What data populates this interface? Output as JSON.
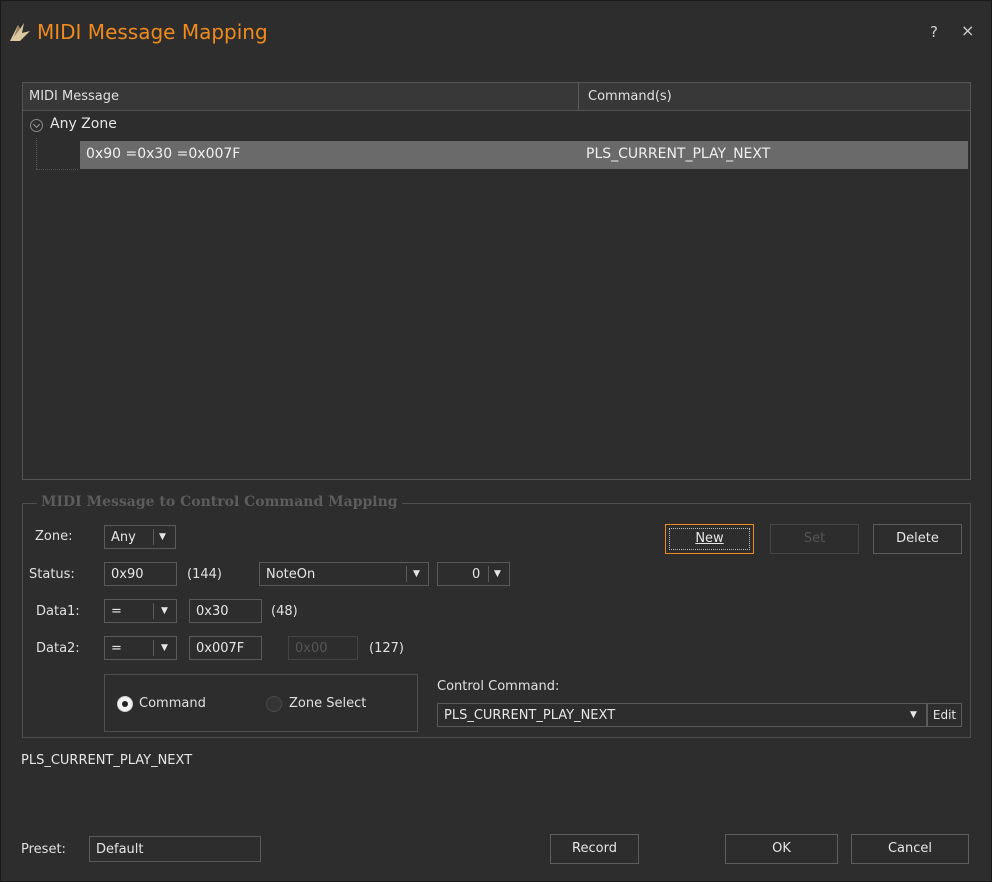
{
  "window": {
    "title": "MIDI Message Mapping",
    "help_label": "?",
    "close_label": "×",
    "accent_color": "#f08a1d"
  },
  "mapping_list": {
    "columns": [
      "MIDI Message",
      "Command(s)"
    ],
    "group_label": "Any Zone",
    "rows": [
      {
        "message": "0x90 =0x30 =0x007F",
        "command": "PLS_CURRENT_PLAY_NEXT"
      }
    ]
  },
  "editor": {
    "group_title": "MIDI Message to Control Command Mapping",
    "zone_label": "Zone:",
    "zone_value": "Any",
    "status_label": "Status:",
    "status_value": "0x90",
    "status_decimal": "(144)",
    "status_type": "NoteOn",
    "status_channel": "0",
    "data1_label": "Data1:",
    "data1_operator": "=",
    "data1_value": "0x30",
    "data1_decimal": "(48)",
    "data2_label": "Data2:",
    "data2_operator": "=",
    "data2_value": "0x007F",
    "data2_range_placeholder": "0x00",
    "data2_decimal": "(127)",
    "buttons": {
      "new": "New",
      "set": "Set",
      "delete": "Delete",
      "edit": "Edit"
    },
    "radio_command": "Command",
    "radio_zone_select": "Zone Select",
    "radio_selected": "Command",
    "control_command_label": "Control Command:",
    "control_command_value": "PLS_CURRENT_PLAY_NEXT"
  },
  "description_text": "PLS_CURRENT_PLAY_NEXT",
  "footer": {
    "preset_label": "Preset:",
    "preset_value": "Default",
    "record": "Record",
    "ok": "OK",
    "cancel": "Cancel"
  }
}
